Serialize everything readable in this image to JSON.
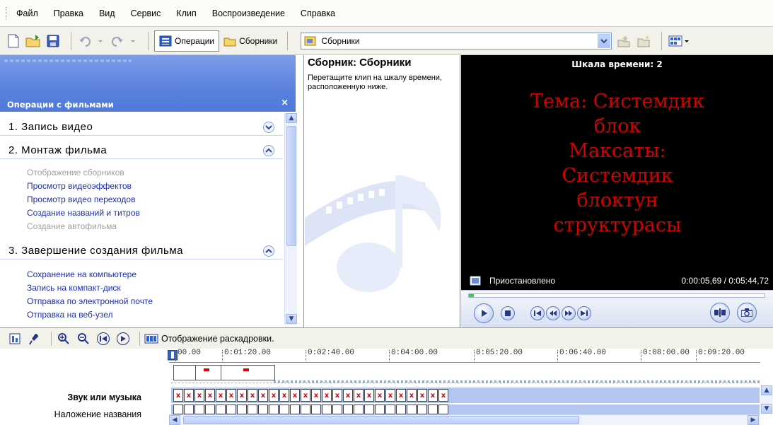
{
  "menu": [
    "Файл",
    "Правка",
    "Вид",
    "Сервис",
    "Клип",
    "Воспроизведение",
    "Справка"
  ],
  "toolbar": {
    "operations_label": "Операции",
    "collections_label": "Сборники",
    "collection_select_value": "Сборники"
  },
  "taskpane": {
    "title": "Операции с фильмами",
    "close": "×",
    "sections": [
      {
        "heading": "1. Запись видео",
        "expanded": false,
        "items": []
      },
      {
        "heading": "2. Монтаж фильма",
        "expanded": true,
        "items": [
          {
            "label": "Отображение сборников",
            "enabled": false
          },
          {
            "label": "Просмотр видеоэффектов",
            "enabled": true
          },
          {
            "label": "Просмотр видео переходов",
            "enabled": true
          },
          {
            "label": "Создание названий и титров",
            "enabled": true
          },
          {
            "label": "Создание автофильма",
            "enabled": false
          }
        ]
      },
      {
        "heading": "3. Завершение создания фильма",
        "expanded": true,
        "items": [
          {
            "label": "Сохранение на компьютере",
            "enabled": true
          },
          {
            "label": "Запись на компакт-диск",
            "enabled": true
          },
          {
            "label": "Отправка по электронной почте",
            "enabled": true
          },
          {
            "label": "Отправка на веб-узел",
            "enabled": true
          }
        ]
      }
    ]
  },
  "collection": {
    "title": "Сборник: Сборники",
    "hint": "Перетащите клип на шкалу времени, расположенную ниже."
  },
  "preview": {
    "title": "Шкала времени: 2",
    "screen_text": "Тема: Системдик\nблок\nМаксаты:\nСистемдик\nблоктун\nструктурасы",
    "status": "Приостановлено",
    "time": "0:00:05,69 / 0:05:44,72",
    "progress": 0.0165
  },
  "timeline": {
    "toolbar_label": "Отображение раскадровки.",
    "ticks": [
      "00.00",
      "0:01:20.00",
      "0:02:40.00",
      "0:04:00.00",
      "0:05:20.00",
      "0:06:40.00",
      "0:08:00.00",
      "0:09:20.00"
    ],
    "tracks": {
      "audio": "Звук или музыка",
      "title_overlay": "Наложение названия"
    }
  },
  "colors": {
    "accent": "#5b82df",
    "link": "#1c2fb5",
    "preview_text": "#d40000",
    "track": "#b3c6ef"
  }
}
